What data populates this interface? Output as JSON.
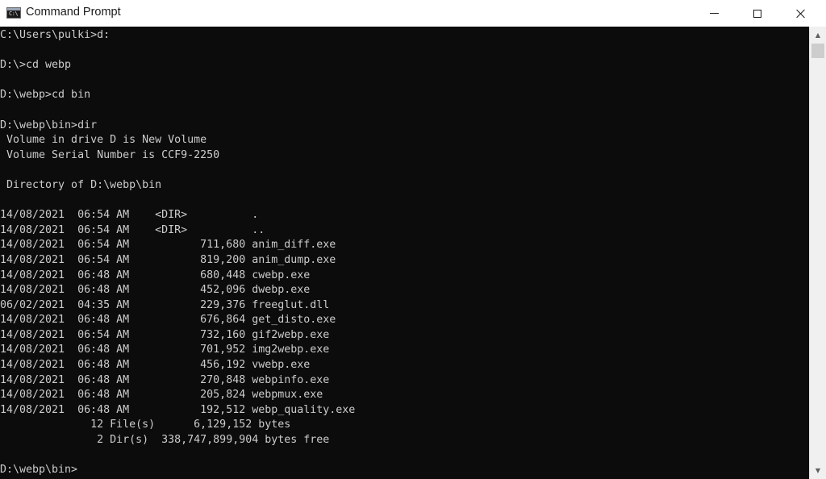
{
  "window": {
    "title": "Command Prompt",
    "icon": "cmd-icon",
    "icon_glyph": "C:\\",
    "controls": {
      "minimize_icon": "minimize-icon",
      "maximize_icon": "maximize-icon",
      "close_icon": "close-icon"
    }
  },
  "console": {
    "lines": [
      "C:\\Users\\pulki>d:",
      "",
      "D:\\>cd webp",
      "",
      "D:\\webp>cd bin",
      "",
      "D:\\webp\\bin>dir",
      " Volume in drive D is New Volume",
      " Volume Serial Number is CCF9-2250",
      "",
      " Directory of D:\\webp\\bin",
      "",
      "14/08/2021  06:54 AM    <DIR>          .",
      "14/08/2021  06:54 AM    <DIR>          ..",
      "14/08/2021  06:54 AM           711,680 anim_diff.exe",
      "14/08/2021  06:54 AM           819,200 anim_dump.exe",
      "14/08/2021  06:48 AM           680,448 cwebp.exe",
      "14/08/2021  06:48 AM           452,096 dwebp.exe",
      "06/02/2021  04:35 AM           229,376 freeglut.dll",
      "14/08/2021  06:48 AM           676,864 get_disto.exe",
      "14/08/2021  06:54 AM           732,160 gif2webp.exe",
      "14/08/2021  06:48 AM           701,952 img2webp.exe",
      "14/08/2021  06:48 AM           456,192 vwebp.exe",
      "14/08/2021  06:48 AM           270,848 webpinfo.exe",
      "14/08/2021  06:48 AM           205,824 webpmux.exe",
      "14/08/2021  06:48 AM           192,512 webp_quality.exe",
      "              12 File(s)      6,129,152 bytes",
      "               2 Dir(s)  338,747,899,904 bytes free",
      "",
      "D:\\webp\\bin>"
    ]
  },
  "scrollbar": {
    "up_icon": "scroll-up-arrow-icon",
    "down_icon": "scroll-down-arrow-icon",
    "position": 0
  },
  "colors": {
    "console_background": "#0c0c0c",
    "console_text": "#cccccc",
    "titlebar_background": "#ffffff"
  }
}
